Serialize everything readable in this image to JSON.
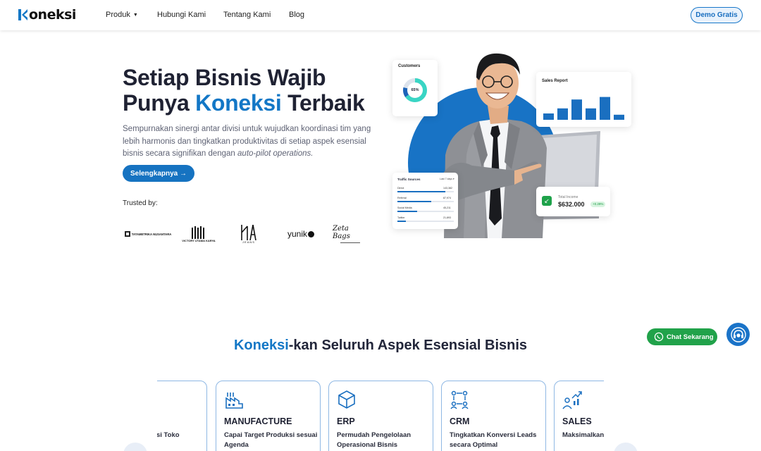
{
  "nav": {
    "logo_text": "oneksi",
    "links": [
      "Produk",
      "Hubungi Kami",
      "Tentang Kami",
      "Blog"
    ],
    "demo_label": "Demo Gratis"
  },
  "hero": {
    "title_line1": "Setiap Bisnis Wajib",
    "title_line2_pre": "Punya ",
    "title_line2_accent": "Koneksi",
    "title_line2_post": " Terbaik",
    "desc_main": "Sempurnakan sinergi antar divisi untuk wujudkan koordinasi tim yang lebih harmonis dan tingkatkan produktivitas di setiap aspek esensial bisnis secara signifikan dengan ",
    "desc_em": "auto-pilot operations.",
    "cta_label": "Selengkapnya →",
    "trusted_label": "Trusted by:",
    "brands": [
      "TATAMETRIKA NUSANTARA",
      "VICTORY UTAMA KARYA",
      "JEANS",
      "yunik",
      "Zeta Bags"
    ]
  },
  "cards": {
    "customers": {
      "title": "Customers",
      "pct": "65%"
    },
    "sales_report": {
      "title": "Sales Report",
      "bars": [
        0.25,
        0.45,
        0.8,
        0.45,
        0.9,
        0.2
      ]
    },
    "traffic": {
      "title": "Traffic Sources",
      "filter": "Last 7 days",
      "rows": [
        {
          "label": "Direct",
          "value": "143,382",
          "fill": 0.85
        },
        {
          "label": "Referral",
          "value": "87,974",
          "fill": 0.6
        },
        {
          "label": "Social Media",
          "value": "45,211",
          "fill": 0.35
        },
        {
          "label": "Twitter",
          "value": "21,893",
          "fill": 0.15
        }
      ]
    },
    "income": {
      "label": "Total Income",
      "value": "$632.000",
      "change": "+0.29%"
    }
  },
  "section": {
    "title_accent": "Koneksi",
    "title_rest": "-kan Seluruh Aspek Esensial Bisnis",
    "features": [
      {
        "name": "",
        "desc": "si Toko",
        "icon": "store-icon"
      },
      {
        "name": "MANUFACTURE",
        "desc": "Capai Target Produksi sesuai Agenda",
        "icon": "factory-icon"
      },
      {
        "name": "ERP",
        "desc": "Permudah Pengelolaan Operasional Bisnis",
        "icon": "box-icon"
      },
      {
        "name": "CRM",
        "desc": "Tingkatkan Konversi Leads secara Optimal",
        "icon": "people-flow-icon"
      },
      {
        "name": "SALES",
        "desc": "Maksimalkan Tim Sales",
        "icon": "sales-chart-icon"
      }
    ]
  },
  "floating": {
    "chat_label": "Chat Sekarang"
  },
  "colors": {
    "primary": "#1377c6",
    "dark_text": "#1f2233",
    "whatsapp": "#21a24a"
  }
}
